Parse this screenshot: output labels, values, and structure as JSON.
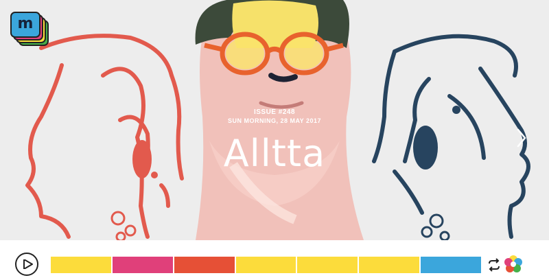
{
  "issue": {
    "number": "ISSUE #248",
    "date": "SUN MORNING, 28 MAY 2017",
    "title": "Alltta"
  },
  "logo": {
    "letter": "m"
  },
  "player": {
    "segments": [
      {
        "color": "#fcdc3b"
      },
      {
        "color": "#e0407a"
      },
      {
        "color": "#e65036"
      },
      {
        "color": "#fcdc3b"
      },
      {
        "color": "#fcdc3b"
      },
      {
        "color": "#fcdc3b"
      },
      {
        "color": "#3ba6dc"
      }
    ]
  },
  "icons": {
    "play": "play-icon",
    "repeat": "repeat-icon",
    "flower": "flower-icon",
    "next": "chevron-right-icon"
  }
}
